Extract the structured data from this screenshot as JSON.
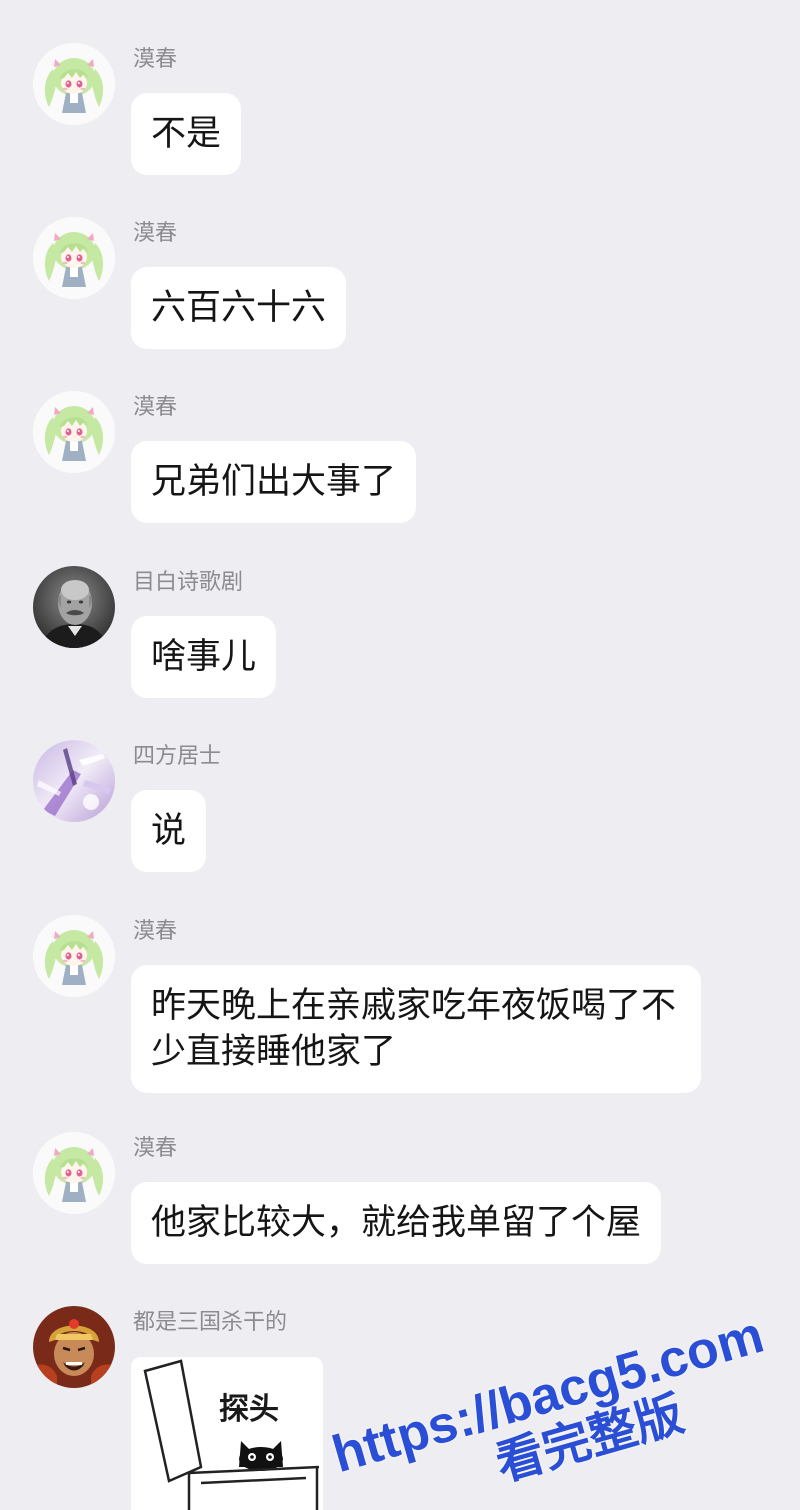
{
  "colors": {
    "background": "#ededf2",
    "bubble": "#ffffff",
    "sender_name": "#8b8b90",
    "text": "#151515",
    "watermark": "#2a4fd6"
  },
  "messages": [
    {
      "sender": "漠春",
      "avatar": "anime-girl-avatar",
      "text": "不是"
    },
    {
      "sender": "漠春",
      "avatar": "anime-girl-avatar",
      "text": "六百六十六"
    },
    {
      "sender": "漠春",
      "avatar": "anime-girl-avatar",
      "text": "兄弟们出大事了"
    },
    {
      "sender": "目白诗歌剧",
      "avatar": "old-man-portrait-avatar",
      "text": "啥事儿"
    },
    {
      "sender": "四方居士",
      "avatar": "purple-abstract-avatar",
      "text": "说"
    },
    {
      "sender": "漠春",
      "avatar": "anime-girl-avatar",
      "text": "昨天晚上在亲戚家吃年夜饭喝了不少直接睡他家了"
    },
    {
      "sender": "漠春",
      "avatar": "anime-girl-avatar",
      "text": "他家比较大，就给我单留了个屋"
    },
    {
      "sender": "都是三国杀干的",
      "avatar": "warrior-avatar",
      "sticker": {
        "icon": "cat-in-box-sticker",
        "caption": "探头"
      }
    }
  ],
  "watermark": {
    "url": "https://bacg5.com",
    "label": "看完整版"
  }
}
